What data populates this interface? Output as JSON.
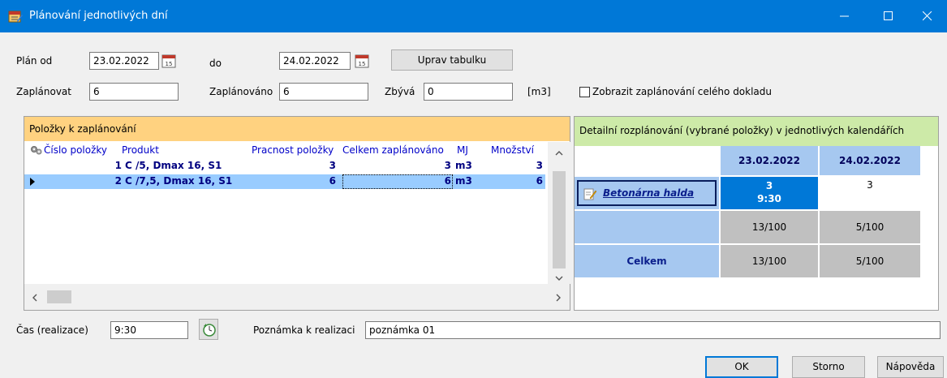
{
  "window": {
    "title": "Plánování jednotlivých dní",
    "icon": "calendar-edit-icon",
    "controls": [
      "minimize-icon",
      "maximize-icon",
      "close-icon"
    ],
    "accent": "#0078d7"
  },
  "form": {
    "plan_from_label": "Plán od",
    "plan_from_value": "23.02.2022",
    "to_label": "do",
    "to_value": "24.02.2022",
    "edit_table_button": "Uprav tabulku",
    "to_plan_label": "Zaplánovat",
    "to_plan_value": "6",
    "planned_label": "Zaplánováno",
    "planned_value": "6",
    "remaining_label": "Zbývá",
    "remaining_value": "0",
    "unit": "[m3]",
    "show_whole_doc_label": "Zobrazit zaplánování celého dokladu",
    "show_whole_doc_checked": false
  },
  "items_panel": {
    "title": "Položky k zaplánování",
    "columns": [
      "Číslo položky",
      "Produkt",
      "Pracnost položky",
      "Celkem zaplánováno",
      "MJ",
      "Množství"
    ],
    "rows": [
      {
        "number": "1",
        "product": "C /5, Dmax 16, S1",
        "effort": "3",
        "total_planned": "3",
        "unit": "m3",
        "quantity": "3",
        "selected": false
      },
      {
        "number": "2",
        "product": "C /7,5, Dmax 16, S1",
        "effort": "6",
        "total_planned": "6",
        "unit": "m3",
        "quantity": "6",
        "selected": true
      }
    ],
    "header_color": "#ffd280",
    "selection_color": "#99ccff"
  },
  "detail_panel": {
    "title": "Detailní rozplánování (vybrané položky) v jednotlivých kalendářích",
    "dates": [
      "23.02.2022",
      "24.02.2022"
    ],
    "calendar": {
      "name": "Betonárna halda",
      "cells": [
        {
          "value": "3",
          "time": "9:30",
          "selected": true
        },
        {
          "value": "3",
          "time": "",
          "selected": false
        }
      ],
      "capacity": [
        "13/100",
        "5/100"
      ]
    },
    "total_label": "Celkem",
    "totals": [
      "13/100",
      "5/100"
    ],
    "header_color": "#cdeaa8",
    "date_header_color": "#a6c8f0",
    "selected_cell_color": "#0078d7"
  },
  "footer": {
    "time_label": "Čas (realizace)",
    "time_value": "9:30",
    "note_label": "Poznámka k realizaci",
    "note_value": "poznámka 01",
    "ok_button": "OK",
    "cancel_button": "Storno",
    "help_button": "Nápověda"
  }
}
